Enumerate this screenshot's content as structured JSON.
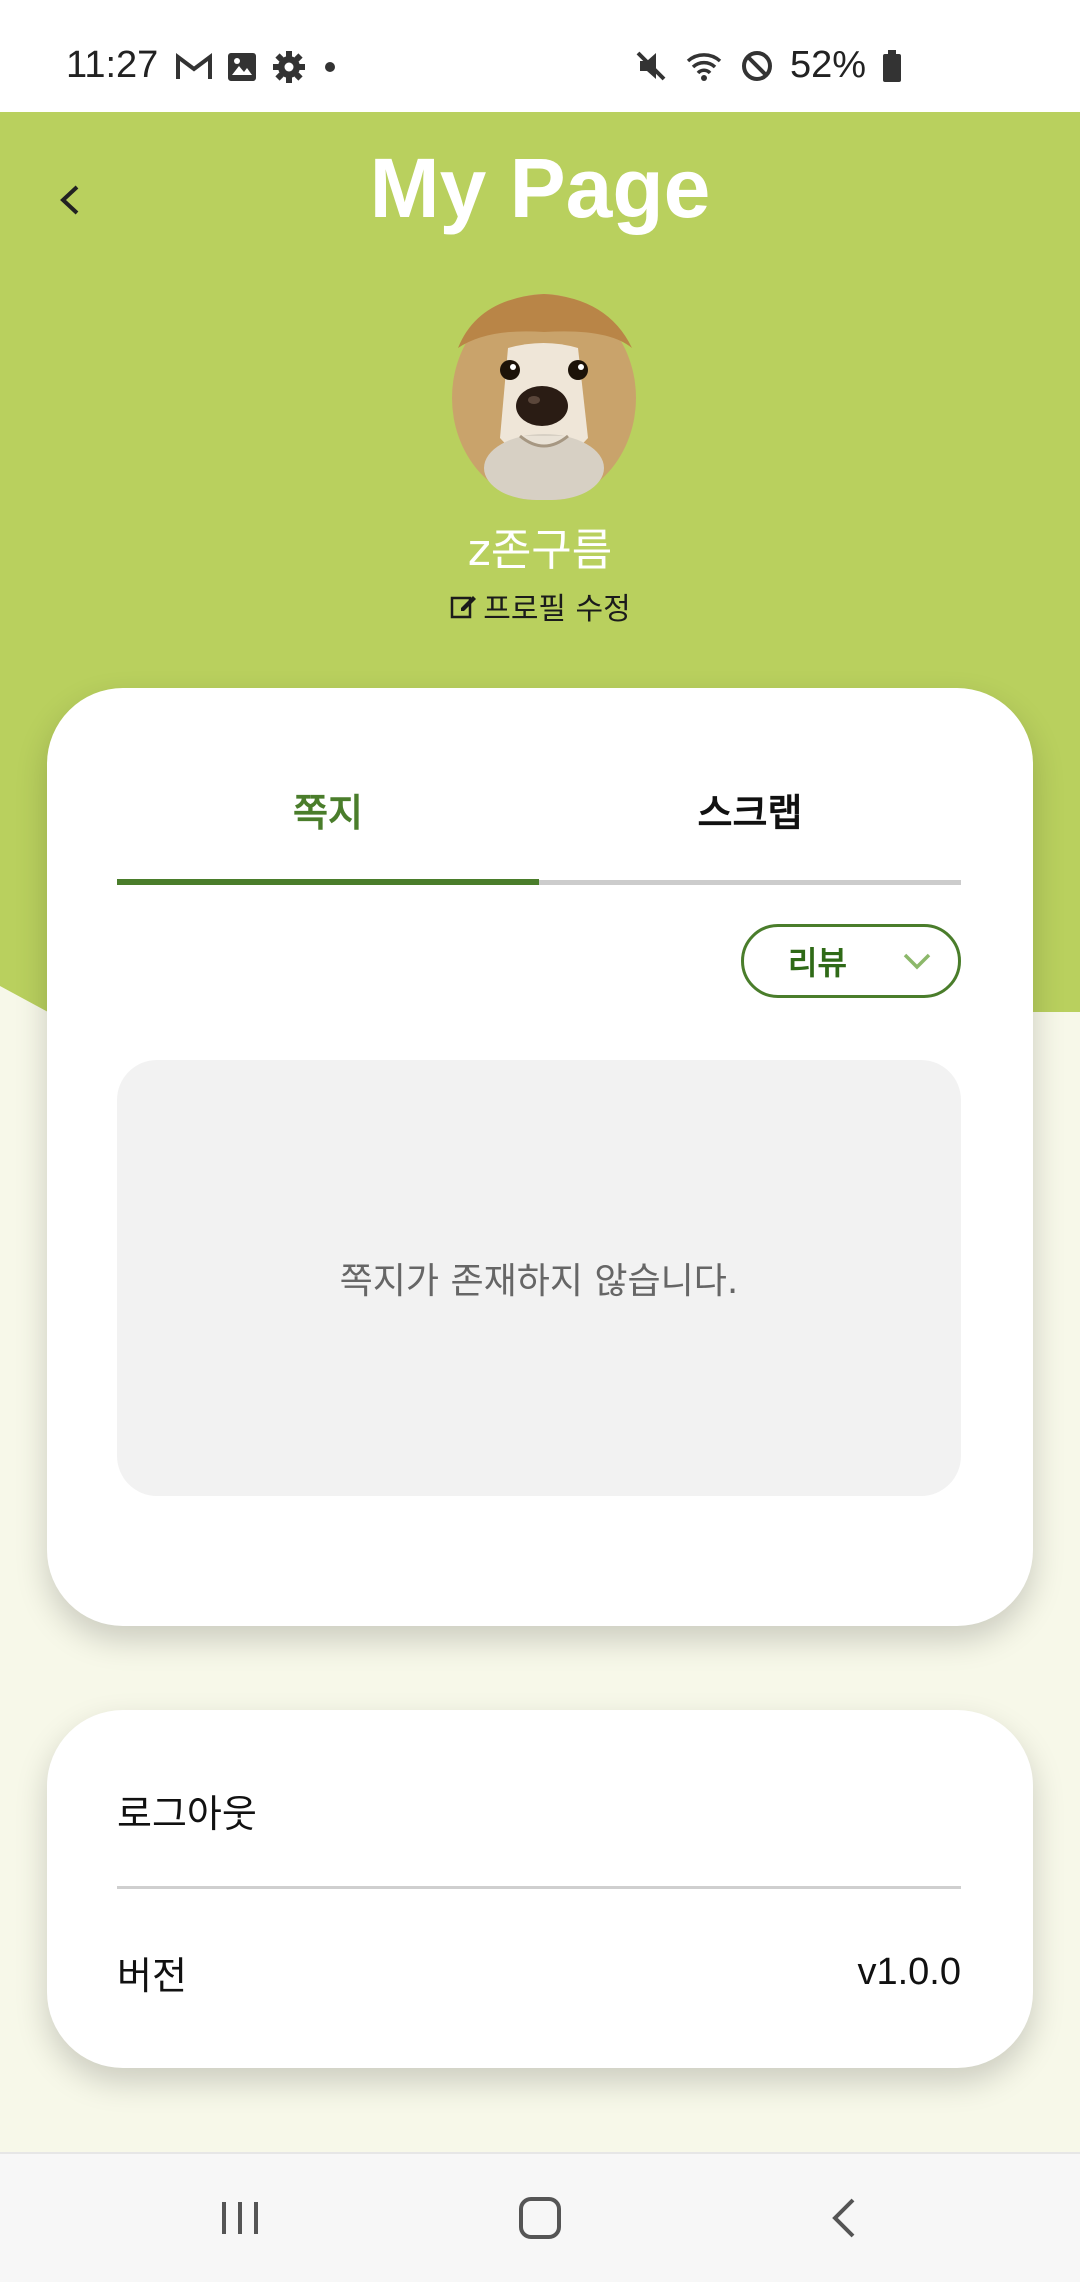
{
  "status_bar": {
    "time": "11:27",
    "battery": "52%",
    "left_icons": [
      "gmail-icon",
      "gallery-icon",
      "settings-icon",
      "dot-icon"
    ],
    "right_icons": [
      "mute-icon",
      "wifi-icon",
      "blocked-icon",
      "battery-icon"
    ]
  },
  "header": {
    "title": "My Page",
    "background_color": "#b9d05e"
  },
  "profile": {
    "username": "z존구름",
    "edit_label": "프로필 수정"
  },
  "tabs": [
    {
      "label": "쪽지",
      "active": true
    },
    {
      "label": "스크랩",
      "active": false
    }
  ],
  "filter": {
    "selected": "리뷰"
  },
  "messages": {
    "empty_text": "쪽지가 존재하지 않습니다."
  },
  "settings": {
    "logout_label": "로그아웃",
    "version_label": "버전",
    "version_value": "v1.0.0"
  },
  "colors": {
    "accent": "#4a7d2b",
    "page_bg": "#f7f8e9"
  }
}
